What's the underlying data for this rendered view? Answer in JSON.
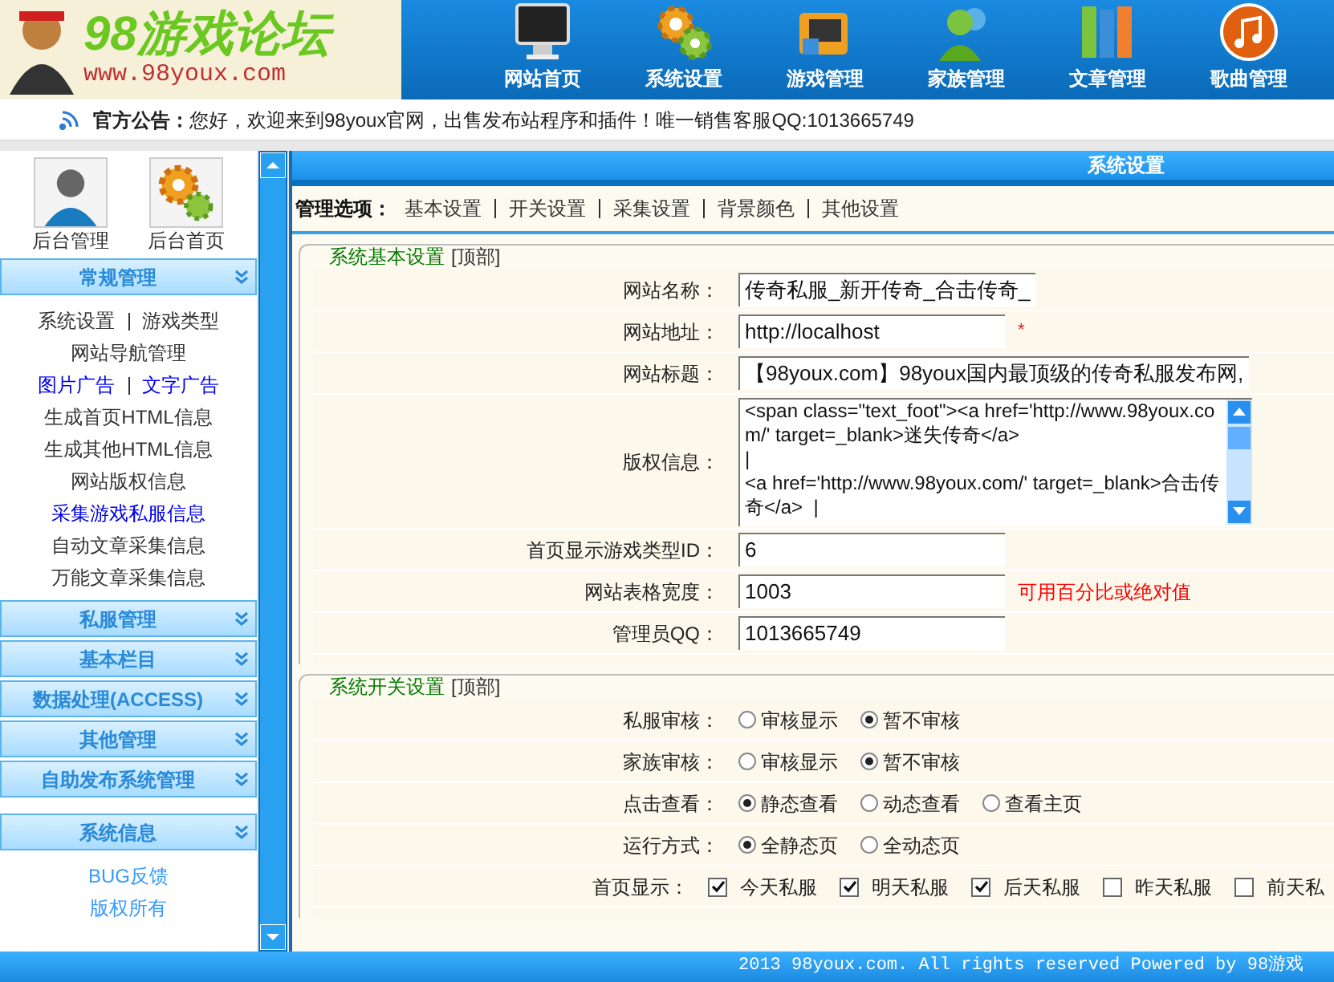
{
  "header": {
    "logo_title": "98游戏论坛",
    "logo_url": "www.98youx.com",
    "nav": [
      {
        "label": "网站首页",
        "kind": "monitor"
      },
      {
        "label": "系统设置",
        "kind": "gears"
      },
      {
        "label": "游戏管理",
        "kind": "game"
      },
      {
        "label": "家族管理",
        "kind": "people"
      },
      {
        "label": "文章管理",
        "kind": "binders"
      },
      {
        "label": "歌曲管理",
        "kind": "music"
      }
    ]
  },
  "notice": {
    "label": "官方公告：",
    "text": "您好，欢迎来到98youx官网，出售发布站程序和插件！唯一销售客服QQ:1013665749"
  },
  "sidebar": {
    "shortcuts": [
      {
        "label": "后台管理",
        "kind": "user"
      },
      {
        "label": "后台首页",
        "kind": "gears"
      }
    ],
    "sections": [
      {
        "title": "常规管理",
        "rows": [
          [
            {
              "label": "系统设置",
              "kind": "plain"
            },
            {
              "label": "游戏类型",
              "kind": "plain"
            }
          ],
          [
            {
              "label": "网站导航管理",
              "kind": "plain"
            }
          ],
          [
            {
              "label": "图片广告",
              "kind": "link"
            },
            {
              "label": "文字广告",
              "kind": "link"
            }
          ],
          [
            {
              "label": "生成首页HTML信息",
              "kind": "plain"
            }
          ],
          [
            {
              "label": "生成其他HTML信息",
              "kind": "plain"
            }
          ],
          [
            {
              "label": "网站版权信息",
              "kind": "plain"
            }
          ],
          [
            {
              "label": "采集游戏私服信息",
              "kind": "link"
            }
          ],
          [
            {
              "label": "自动文章采集信息",
              "kind": "plain"
            }
          ],
          [
            {
              "label": "万能文章采集信息",
              "kind": "plain"
            }
          ]
        ]
      },
      {
        "title": "私服管理"
      },
      {
        "title": "基本栏目"
      },
      {
        "title": "数据处理(ACCESS)"
      },
      {
        "title": "其他管理"
      },
      {
        "title": "自助发布系统管理"
      },
      {
        "title": "系统信息",
        "rows": [
          [
            {
              "label": "BUG反馈",
              "kind": "info"
            }
          ],
          [
            {
              "label": "版权所有",
              "kind": "info"
            }
          ]
        ]
      }
    ]
  },
  "main": {
    "title": "系统设置",
    "options_label": "管理选项：",
    "options": [
      "基本设置",
      "开关设置",
      "采集设置",
      "背景颜色",
      "其他设置"
    ],
    "groups": [
      {
        "title": "系统基本设置",
        "top_link": "[顶部]",
        "rows": [
          {
            "label": "网站名称：",
            "kind": "input",
            "value": "传奇私服_新开传奇_合击传奇_"
          },
          {
            "label": "网站地址：",
            "kind": "input",
            "value": "http://localhost",
            "marker": "*"
          },
          {
            "label": "网站标题：",
            "kind": "input",
            "value": "【98youx.com】98youx国内最顶级的传奇私服发布网,"
          },
          {
            "label": "版权信息：",
            "kind": "textarea",
            "value": "<span class=\"text_foot\"><a href='http://www.98youx.com/' target=_blank>迷失传奇</a>\n|\n<a href='http://www.98youx.com/' target=_blank>合击传奇</a>  |"
          },
          {
            "label": "首页显示游戏类型ID：",
            "kind": "input",
            "value": "6"
          },
          {
            "label": "网站表格宽度：",
            "kind": "input",
            "value": "1003",
            "note": "可用百分比或绝对值"
          },
          {
            "label": "管理员QQ：",
            "kind": "input",
            "value": "1013665749"
          }
        ]
      },
      {
        "title": "系统开关设置",
        "top_link": "[顶部]",
        "rows": [
          {
            "label": "私服审核：",
            "kind": "radio",
            "options": [
              {
                "label": "审核显示",
                "selected": false
              },
              {
                "label": "暂不审核",
                "selected": true
              }
            ]
          },
          {
            "label": "家族审核：",
            "kind": "radio",
            "options": [
              {
                "label": "审核显示",
                "selected": false
              },
              {
                "label": "暂不审核",
                "selected": true
              }
            ]
          },
          {
            "label": "点击查看：",
            "kind": "radio",
            "options": [
              {
                "label": "静态查看",
                "selected": true
              },
              {
                "label": "动态查看",
                "selected": false
              },
              {
                "label": "查看主页",
                "selected": false
              }
            ]
          },
          {
            "label": "运行方式：",
            "kind": "radio",
            "options": [
              {
                "label": "全静态页",
                "selected": true
              },
              {
                "label": "全动态页",
                "selected": false
              }
            ]
          },
          {
            "label": "首页显示：",
            "kind": "checkbox",
            "options": [
              {
                "label": "今天私服",
                "checked": true
              },
              {
                "label": "明天私服",
                "checked": true
              },
              {
                "label": "后天私服",
                "checked": true
              },
              {
                "label": "昨天私服",
                "checked": false
              },
              {
                "label": "前天私",
                "checked": false
              }
            ]
          }
        ]
      }
    ]
  },
  "footer": "2013 98youx.com. All rights reserved Powered by 98游戏"
}
